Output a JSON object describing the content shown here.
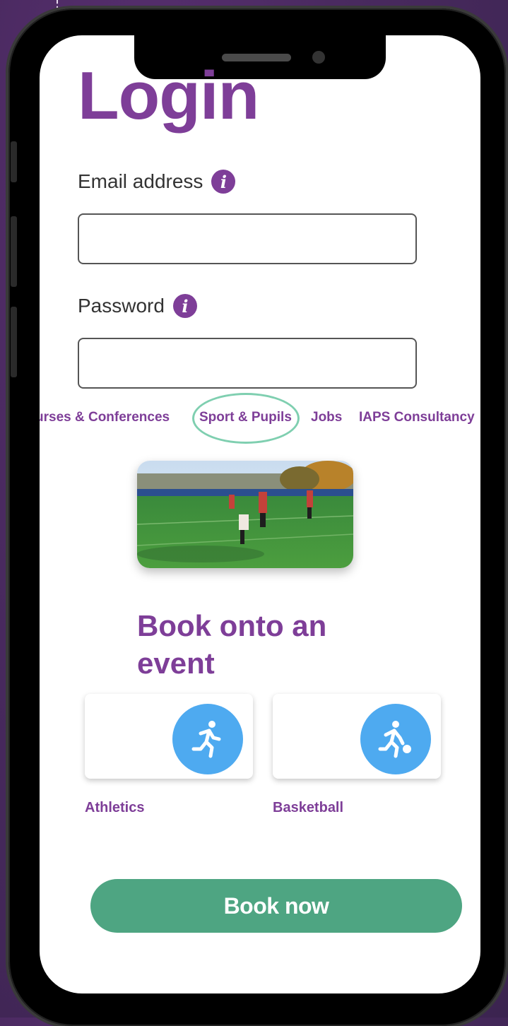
{
  "login": {
    "title": "Login",
    "email_label": "Email address",
    "email_value": "",
    "password_label": "Password",
    "password_value": ""
  },
  "nav": {
    "items": [
      {
        "label": "urses & Conferences"
      },
      {
        "label": "Sport & Pupils",
        "selected": true
      },
      {
        "label": "Jobs"
      },
      {
        "label": "IAPS Consultancy"
      }
    ]
  },
  "events": {
    "heading": "Book onto an event",
    "cards": [
      {
        "label": "Athletics",
        "icon": "running-person-icon"
      },
      {
        "label": "Basketball",
        "icon": "basketball-player-icon"
      }
    ]
  },
  "book_button": "Book now",
  "colors": {
    "brand_purple": "#7e3e98",
    "accent_green": "#4ea582",
    "highlight_mint": "#7fcfb0",
    "icon_blue": "#4eaaf0"
  }
}
